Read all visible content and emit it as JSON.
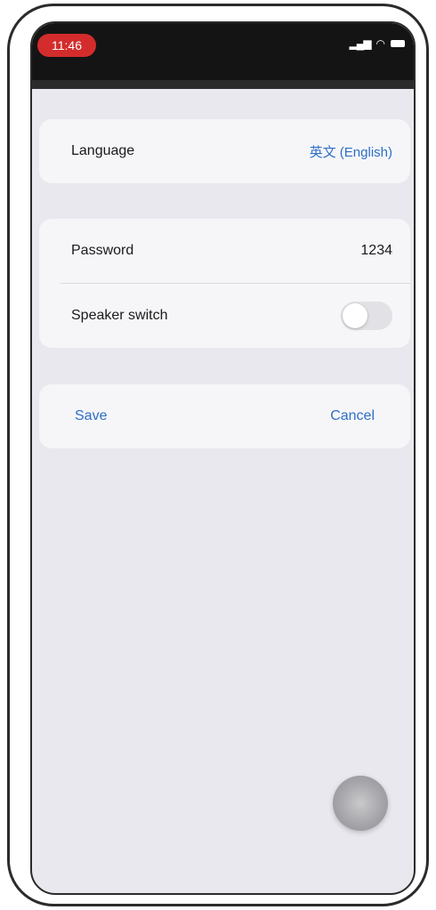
{
  "status_bar": {
    "time": "11:46",
    "signal_icon": "signal-bars-icon",
    "wifi_icon": "wifi-icon",
    "battery_icon": "battery-icon"
  },
  "settings": {
    "language": {
      "label": "Language",
      "value": "英文 (English)"
    },
    "password": {
      "label": "Password",
      "value": "1234"
    },
    "speaker_switch": {
      "label": "Speaker switch",
      "enabled": false
    }
  },
  "actions": {
    "save_label": "Save",
    "cancel_label": "Cancel"
  },
  "colors": {
    "accent": "#2f6fc4",
    "status_time_pill": "#d42c2c",
    "background": "#e8e8ee",
    "card": "#f6f6f9"
  },
  "floating_button_icon": "assistive-touch-icon"
}
